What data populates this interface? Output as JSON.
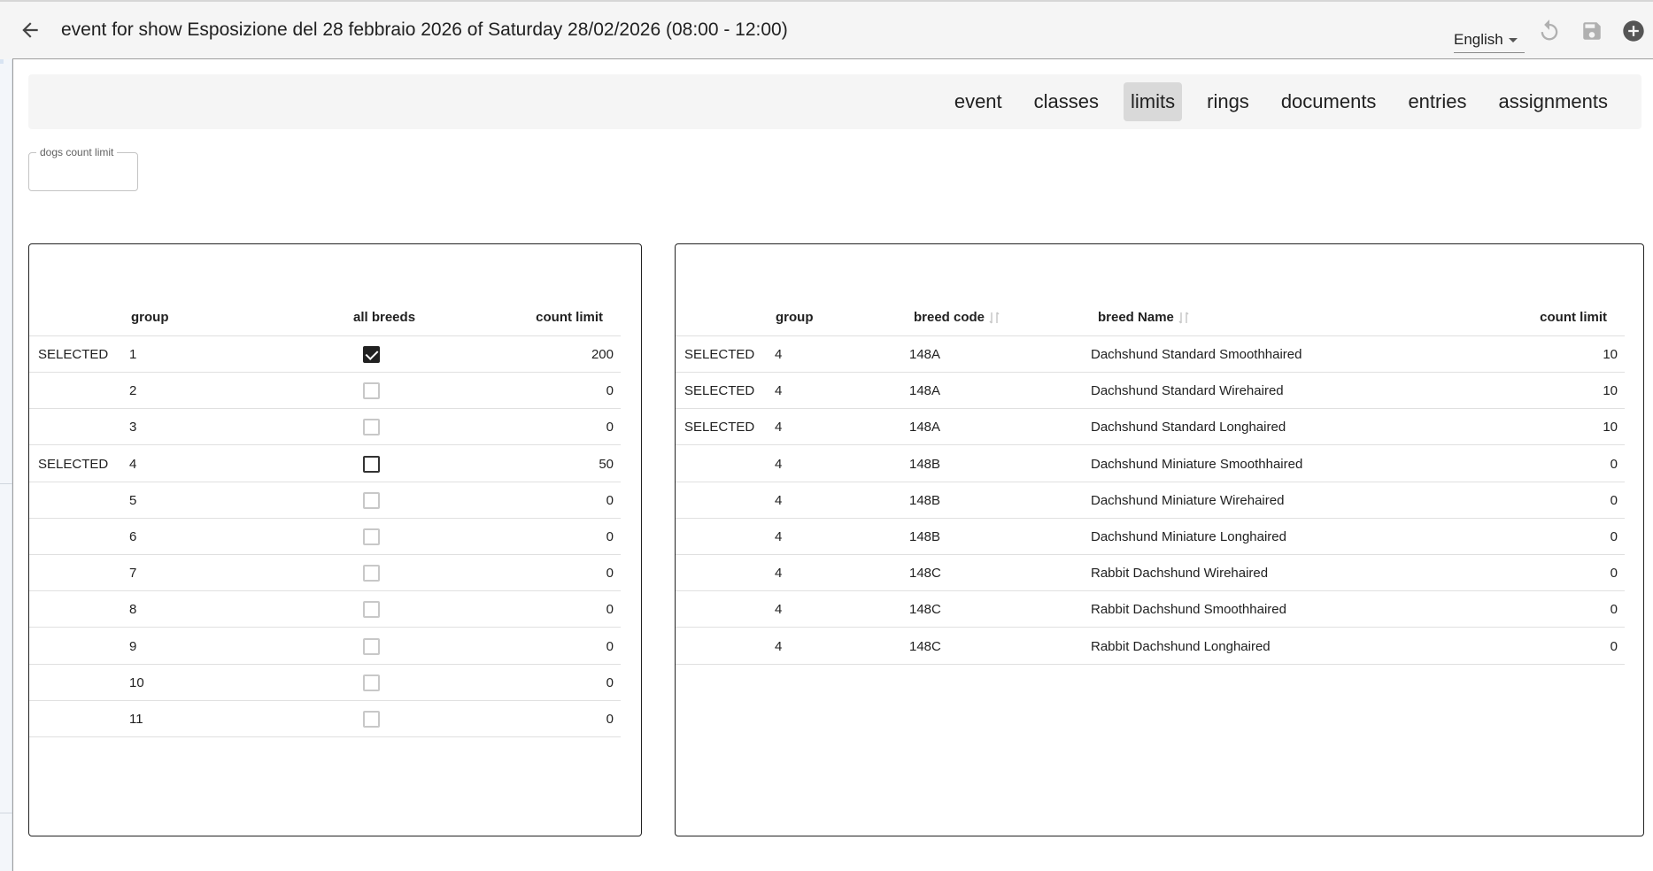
{
  "header": {
    "title": "event for show Esposizione del 28 febbraio 2026 of Saturday 28/02/2026 (08:00 - 12:00)",
    "language": "English",
    "icons": [
      "back-arrow-icon",
      "undo-icon",
      "save-icon",
      "add-circle-icon"
    ]
  },
  "tabs": [
    {
      "label": "event",
      "active": false
    },
    {
      "label": "classes",
      "active": false
    },
    {
      "label": "limits",
      "active": true
    },
    {
      "label": "rings",
      "active": false
    },
    {
      "label": "documents",
      "active": false
    },
    {
      "label": "entries",
      "active": false
    },
    {
      "label": "assignments",
      "active": false
    }
  ],
  "dogs_limit": {
    "label": "dogs count limit",
    "value": ""
  },
  "groups_table": {
    "headers": {
      "group": "group",
      "all_breeds": "all breeds",
      "count_limit": "count limit"
    },
    "rows": [
      {
        "selected": "SELECTED",
        "group": "1",
        "all_breeds": true,
        "count_limit": "200",
        "box": "checked"
      },
      {
        "selected": "",
        "group": "2",
        "all_breeds": false,
        "count_limit": "0",
        "box": "light"
      },
      {
        "selected": "",
        "group": "3",
        "all_breeds": false,
        "count_limit": "0",
        "box": "light"
      },
      {
        "selected": "SELECTED",
        "group": "4",
        "all_breeds": false,
        "count_limit": "50",
        "box": "dark"
      },
      {
        "selected": "",
        "group": "5",
        "all_breeds": false,
        "count_limit": "0",
        "box": "light"
      },
      {
        "selected": "",
        "group": "6",
        "all_breeds": false,
        "count_limit": "0",
        "box": "light"
      },
      {
        "selected": "",
        "group": "7",
        "all_breeds": false,
        "count_limit": "0",
        "box": "light"
      },
      {
        "selected": "",
        "group": "8",
        "all_breeds": false,
        "count_limit": "0",
        "box": "light"
      },
      {
        "selected": "",
        "group": "9",
        "all_breeds": false,
        "count_limit": "0",
        "box": "light"
      },
      {
        "selected": "",
        "group": "10",
        "all_breeds": false,
        "count_limit": "0",
        "box": "light"
      },
      {
        "selected": "",
        "group": "11",
        "all_breeds": false,
        "count_limit": "0",
        "box": "light"
      }
    ]
  },
  "breeds_table": {
    "headers": {
      "group": "group",
      "breed_code": "breed code",
      "breed_name": "breed Name",
      "count_limit": "count limit"
    },
    "rows": [
      {
        "selected": "SELECTED",
        "group": "4",
        "breed_code": "148A",
        "breed_name": "Dachshund Standard Smoothhaired",
        "count_limit": "10"
      },
      {
        "selected": "SELECTED",
        "group": "4",
        "breed_code": "148A",
        "breed_name": "Dachshund Standard Wirehaired",
        "count_limit": "10"
      },
      {
        "selected": "SELECTED",
        "group": "4",
        "breed_code": "148A",
        "breed_name": "Dachshund Standard Longhaired",
        "count_limit": "10"
      },
      {
        "selected": "",
        "group": "4",
        "breed_code": "148B",
        "breed_name": "Dachshund Miniature Smoothhaired",
        "count_limit": "0"
      },
      {
        "selected": "",
        "group": "4",
        "breed_code": "148B",
        "breed_name": "Dachshund Miniature Wirehaired",
        "count_limit": "0"
      },
      {
        "selected": "",
        "group": "4",
        "breed_code": "148B",
        "breed_name": "Dachshund Miniature Longhaired",
        "count_limit": "0"
      },
      {
        "selected": "",
        "group": "4",
        "breed_code": "148C",
        "breed_name": "Rabbit Dachshund Wirehaired",
        "count_limit": "0"
      },
      {
        "selected": "",
        "group": "4",
        "breed_code": "148C",
        "breed_name": "Rabbit Dachshund Smoothhaired",
        "count_limit": "0"
      },
      {
        "selected": "",
        "group": "4",
        "breed_code": "148C",
        "breed_name": "Rabbit Dachshund Longhaired",
        "count_limit": "0"
      }
    ]
  },
  "colors": {
    "header_bg": "#f5f5f5",
    "active_tab_bg": "#d9d9d9",
    "text": "#212121",
    "checkbox_checked": "#212121"
  }
}
